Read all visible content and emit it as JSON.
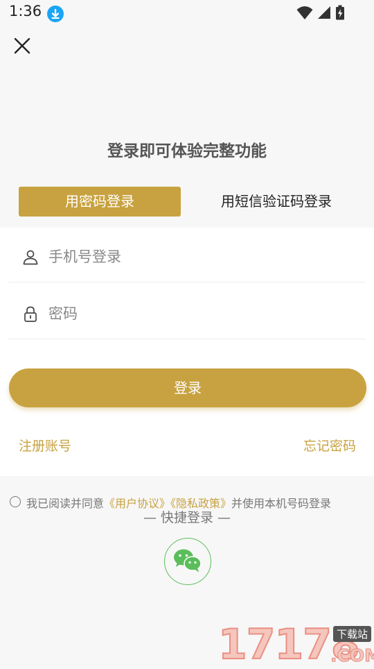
{
  "status_bar": {
    "time": "1:36",
    "download_icon": "download-arrow-icon",
    "icons": [
      "wifi-icon",
      "signal-icon",
      "battery-charging-icon"
    ]
  },
  "close_icon": "close-icon",
  "headline": "登录即可体验完整功能",
  "tabs": [
    {
      "label": "用密码登录",
      "active": true
    },
    {
      "label": "用短信验证码登录",
      "active": false
    }
  ],
  "form": {
    "phone_placeholder": "手机号登录",
    "phone_value": "",
    "phone_icon": "user-icon",
    "password_placeholder": "密码",
    "password_value": "",
    "password_icon": "lock-icon"
  },
  "login_button": "登录",
  "links": {
    "register": "注册账号",
    "forgot": "忘记密码"
  },
  "agreement": {
    "prefix": "我已阅读并同意",
    "user_agreement": "《用户协议》",
    "privacy_policy": "《隐私政策》",
    "suffix": "并使用本机号码登录",
    "checked": false
  },
  "quick_login_label": "— 快捷登录 —",
  "wechat_icon": "wechat-icon",
  "watermark": {
    "number": "17178",
    "tag": "下载站",
    "domain": ".COM"
  },
  "colors": {
    "accent": "#c8a240",
    "background": "#f7f7f7",
    "panel": "#ffffff",
    "wechat_green": "#5bbd5b",
    "download_badge": "#1aa5f5"
  }
}
